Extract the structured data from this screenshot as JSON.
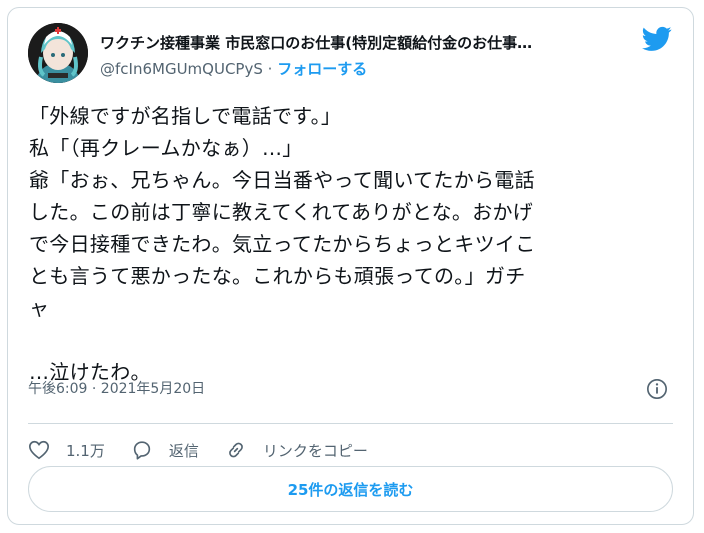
{
  "author": {
    "name": "ワクチン接種事業 市民窓口のお仕事(特別定額給付金のお仕事…",
    "handle": "@fcIn6MGUmQUCPyS",
    "separator": "·",
    "follow_label": "フォローする"
  },
  "tweet": {
    "text": "「外線ですが名指しで電話です。」\n私「（再クレームかなぁ）…」\n爺「おぉ、兄ちゃん。今日当番やって聞いてたから電話\nした。この前は丁寧に教えてくれてありがとな。おかげ\nで今日接種できたわ。気立ってたからちょっとキツイこ\nとも言うて悪かったな。これからも頑張っての。」ガチ\nャ\n\n…泣けたわ。",
    "timestamp": "午後6:09 · 2021年5月20日"
  },
  "actions": {
    "like_count": "1.1万",
    "reply_label": "返信",
    "copy_link_label": "リンクをコピー"
  },
  "read_replies_label": "25件の返信を読む",
  "icons": {
    "logo": "twitter-bird-icon",
    "info": "info-icon",
    "like": "heart-icon",
    "reply": "speech-bubble-icon",
    "link": "link-icon"
  },
  "colors": {
    "accent": "#1d9bf0",
    "muted": "#536471",
    "border": "#cfd9de"
  }
}
